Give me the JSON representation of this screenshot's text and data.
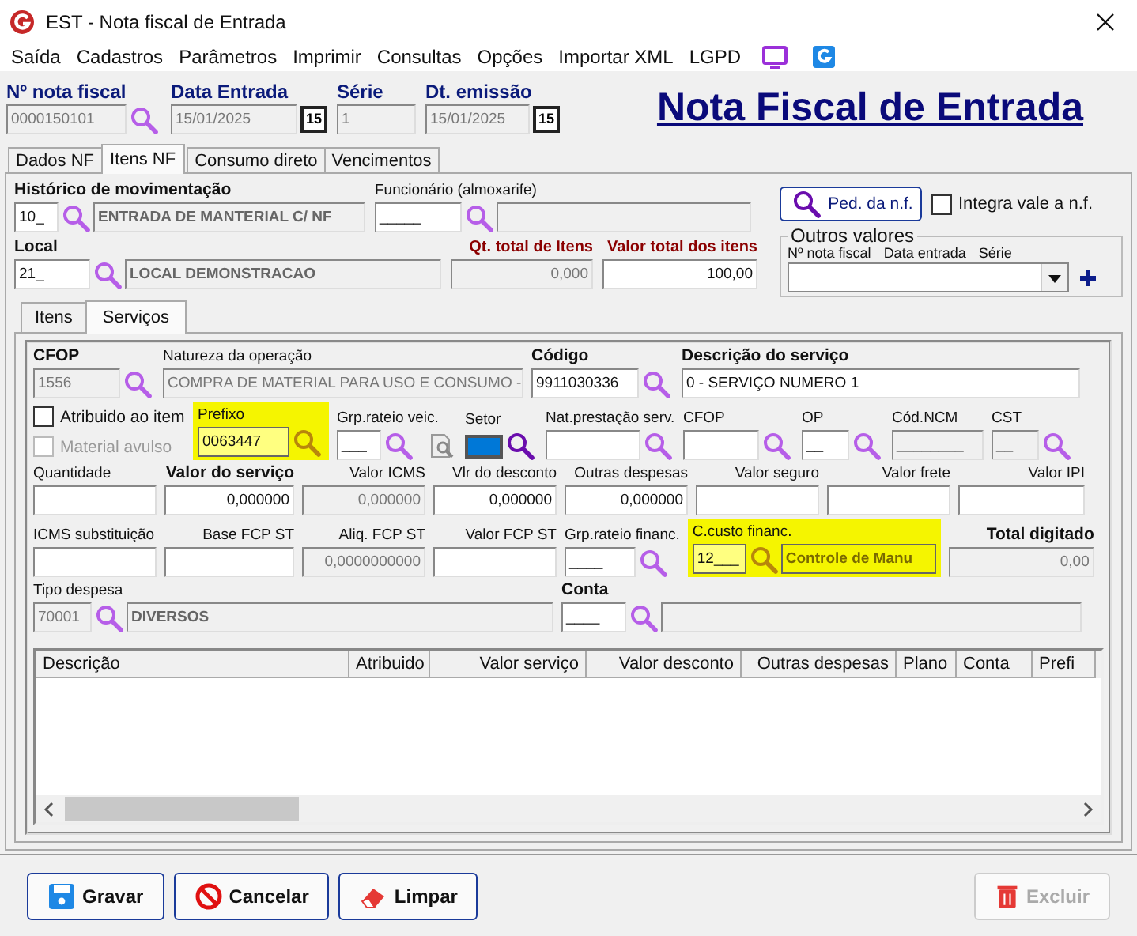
{
  "window": {
    "title": "EST - Nota fiscal de Entrada"
  },
  "menu": [
    "Saída",
    "Cadastros",
    "Parâmetros",
    "Imprimir",
    "Consultas",
    "Opções",
    "Importar XML",
    "LGPD"
  ],
  "header": {
    "fields": [
      {
        "label": "Nº nota fiscal",
        "kind": "lookup_input",
        "value": "0000150101"
      },
      {
        "label": "Data Entrada",
        "kind": "date",
        "value": "15/01/2025",
        "calendar": "15"
      },
      {
        "label": "Série",
        "kind": "text",
        "value": "1"
      },
      {
        "label": "Dt. emissão",
        "kind": "date",
        "value": "15/01/2025",
        "calendar": "15"
      }
    ],
    "title": "Nota Fiscal de Entrada"
  },
  "tabs": [
    {
      "label": "Dados NF",
      "selected": false
    },
    {
      "label": "Itens NF",
      "selected": true
    },
    {
      "label": "Consumo direto",
      "selected": false
    },
    {
      "label": "Vencimentos",
      "selected": false
    }
  ],
  "general": {
    "movement": {
      "label": "Histórico de movimentação",
      "controls": [
        {
          "kind": "input",
          "value": "10_"
        },
        {
          "kind": "lookup"
        },
        {
          "kind": "desc",
          "value": "ENTRADA DE MANTERIAL C/ NF"
        }
      ]
    },
    "employee": {
      "label": "Funcionário (almoxarife)",
      "controls": [
        {
          "kind": "input",
          "value": "_____"
        },
        {
          "kind": "lookup"
        },
        {
          "kind": "desc"
        }
      ]
    },
    "order_button": "Ped. da n.f.",
    "integrate": {
      "label": "Integra vale a n.f.",
      "checked": false
    },
    "other_values": {
      "title": "Outros valores",
      "columns": [
        "Nº nota fiscal",
        "Data entrada",
        "Série"
      ]
    },
    "location": {
      "label": "Local",
      "controls": [
        {
          "kind": "input",
          "value": "21_"
        },
        {
          "kind": "lookup"
        },
        {
          "kind": "desc",
          "value": "LOCAL DEMONSTRACAO"
        }
      ]
    },
    "item_quantity": {
      "label": "Qt. total de Itens",
      "controls": [
        {
          "kind": "readonly_number",
          "value": "0,000"
        }
      ]
    },
    "item_total": {
      "label": "Valor total dos itens",
      "controls": [
        {
          "kind": "number",
          "value": "100,00"
        }
      ]
    }
  },
  "subtabs": [
    {
      "label": "Itens",
      "selected": false
    },
    {
      "label": "Serviços",
      "selected": true
    }
  ],
  "service": {
    "lines": [
      {
        "fields": [
          {
            "label": "CFOP",
            "highlighted": false,
            "controls": [
              {
                "kind": "readonly",
                "value": "1556"
              },
              {
                "kind": "lookup"
              }
            ]
          },
          {
            "label": "Natureza da operação",
            "highlighted": false,
            "controls": [
              {
                "kind": "readonly",
                "value": "COMPRA DE MATERIAL PARA USO E CONSUMO -"
              }
            ]
          },
          {
            "label": "Código",
            "highlighted": false,
            "controls": [
              {
                "kind": "input",
                "value": "9911030336"
              },
              {
                "kind": "lookup"
              }
            ]
          },
          {
            "label": "Descrição do serviço",
            "highlighted": false,
            "controls": [
              {
                "kind": "input",
                "value": "0 - SERVIÇO NUMERO 1"
              }
            ]
          }
        ]
      },
      {
        "fields": [
          {
            "highlighted": false,
            "controls": [
              {
                "kind": "checkbox",
                "label": "Atribuido ao item",
                "checked": false,
                "disabled": false
              },
              {
                "kind": "checkbox",
                "label": "Material avulso",
                "checked": false,
                "disabled": true
              }
            ]
          },
          {
            "label": "Prefixo",
            "highlighted": true,
            "controls": [
              {
                "kind": "input",
                "value": "0063447"
              },
              {
                "kind": "lookup"
              }
            ]
          },
          {
            "label": "Grp.rateio veic.",
            "highlighted": false,
            "controls": [
              {
                "kind": "input",
                "value": "___"
              },
              {
                "kind": "lookup"
              },
              {
                "kind": "doc_icon"
              }
            ]
          },
          {
            "label": "Setor",
            "highlighted": false,
            "controls": [
              {
                "kind": "swatch",
                "color": "#0078d7"
              },
              {
                "kind": "lookup"
              }
            ]
          },
          {
            "label": "Nat.prestação serv.",
            "highlighted": false,
            "controls": [
              {
                "kind": "input"
              },
              {
                "kind": "lookup"
              }
            ]
          },
          {
            "label": "CFOP",
            "highlighted": false,
            "controls": [
              {
                "kind": "input"
              },
              {
                "kind": "lookup"
              }
            ]
          },
          {
            "label": "OP",
            "highlighted": false,
            "controls": [
              {
                "kind": "input",
                "value": "__"
              },
              {
                "kind": "lookup"
              }
            ]
          },
          {
            "label": "Cód.NCM",
            "highlighted": false,
            "controls": [
              {
                "kind": "readonly",
                "value": "________"
              }
            ]
          },
          {
            "label": "CST",
            "highlighted": false,
            "controls": [
              {
                "kind": "readonly",
                "value": "__"
              },
              {
                "kind": "lookup"
              }
            ]
          }
        ]
      },
      {
        "fields": [
          {
            "label": "Quantidade",
            "highlighted": false,
            "controls": [
              {
                "kind": "input"
              }
            ]
          },
          {
            "label": "Valor do serviço",
            "highlighted": false,
            "controls": [
              {
                "kind": "number",
                "value": "0,000000"
              }
            ]
          },
          {
            "label": "Valor ICMS",
            "highlighted": false,
            "controls": [
              {
                "kind": "readonly_number",
                "value": "0,000000"
              }
            ]
          },
          {
            "label": "Vlr do desconto",
            "highlighted": false,
            "controls": [
              {
                "kind": "number",
                "value": "0,000000"
              }
            ]
          },
          {
            "label": "Outras despesas",
            "highlighted": false,
            "controls": [
              {
                "kind": "number",
                "value": "0,000000"
              }
            ]
          },
          {
            "label": "Valor seguro",
            "highlighted": false,
            "controls": [
              {
                "kind": "number"
              }
            ]
          },
          {
            "label": "Valor frete",
            "highlighted": false,
            "controls": [
              {
                "kind": "number"
              }
            ]
          },
          {
            "label": "Valor IPI",
            "highlighted": false,
            "controls": [
              {
                "kind": "number"
              }
            ]
          }
        ]
      },
      {
        "fields": [
          {
            "label": "ICMS substituição",
            "highlighted": false,
            "controls": [
              {
                "kind": "input"
              }
            ]
          },
          {
            "label": "Base FCP ST",
            "highlighted": false,
            "controls": [
              {
                "kind": "number"
              }
            ]
          },
          {
            "label": "Aliq. FCP ST",
            "highlighted": false,
            "controls": [
              {
                "kind": "readonly_number",
                "value": "0,0000000000"
              }
            ]
          },
          {
            "label": "Valor FCP ST",
            "highlighted": false,
            "controls": [
              {
                "kind": "number"
              }
            ]
          },
          {
            "label": "Grp.rateio financ.",
            "highlighted": false,
            "controls": [
              {
                "kind": "input",
                "value": "____"
              },
              {
                "kind": "lookup"
              }
            ]
          },
          {
            "label": "C.custo financ.",
            "highlighted": true,
            "controls": [
              {
                "kind": "input",
                "value": "12___"
              },
              {
                "kind": "lookup"
              },
              {
                "kind": "desc",
                "value": "Controle de Manu"
              }
            ]
          },
          {
            "label": "Total digitado",
            "highlighted": false,
            "controls": [
              {
                "kind": "readonly_number",
                "value": "0,00"
              }
            ]
          }
        ]
      },
      {
        "fields": [
          {
            "label": "Tipo despesa",
            "highlighted": false,
            "controls": [
              {
                "kind": "readonly",
                "value": "70001"
              },
              {
                "kind": "lookup"
              },
              {
                "kind": "desc",
                "value": "DIVERSOS"
              }
            ]
          },
          {
            "label": "Conta",
            "highlighted": false,
            "controls": [
              {
                "kind": "input",
                "value": "____"
              },
              {
                "kind": "lookup"
              },
              {
                "kind": "desc"
              }
            ]
          }
        ]
      }
    ]
  },
  "table": {
    "columns": [
      "Descrição",
      "Atribuido",
      "Valor serviço",
      "Valor desconto",
      "Outras despesas",
      "Plano",
      "Conta",
      "Prefi"
    ]
  },
  "buttons": [
    {
      "label": "Gravar",
      "disabled": false
    },
    {
      "label": "Cancelar",
      "disabled": false
    },
    {
      "label": "Limpar",
      "disabled": false
    },
    {
      "label": "Excluir",
      "disabled": true
    }
  ]
}
